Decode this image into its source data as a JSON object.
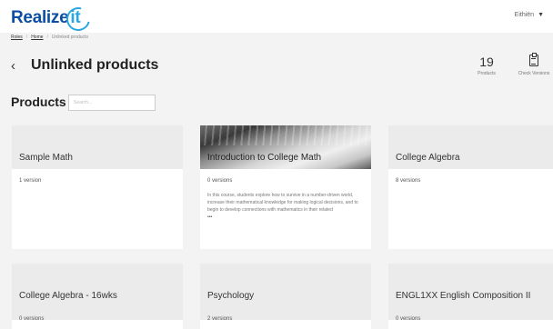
{
  "header": {
    "logo_main": "Realize",
    "logo_accent": "it",
    "user_name": "Eithiën",
    "user_caret": "▼"
  },
  "breadcrumb": {
    "items": [
      "Roles",
      "Home",
      "Unlinked products"
    ],
    "separator": "/"
  },
  "page": {
    "back_icon": "‹",
    "title": "Unlinked products"
  },
  "stats": {
    "products_count": "19",
    "products_label": "Products",
    "check_label": "Check Versions"
  },
  "products": {
    "label": "Products",
    "search_placeholder": "Search..."
  },
  "cards": [
    {
      "title": "Sample Math",
      "versions": "1 version",
      "description": "",
      "more": "",
      "has_image": false
    },
    {
      "title": "Introduction to College Math",
      "versions": "0 versions",
      "description": "In this course, students explore how to survive in a number-driven world, increase their mathematical knowledge for making logical decisions, and to begin to develop connections with mathematics in their related",
      "more": "•••",
      "has_image": true
    },
    {
      "title": "College Algebra",
      "versions": "8 versions",
      "description": "",
      "more": "",
      "has_image": false
    },
    {
      "title": "College Algebra - 16wks",
      "versions": "0 versions",
      "description": "",
      "more": "",
      "has_image": false
    },
    {
      "title": "Psychology",
      "versions": "2 versions",
      "description": "",
      "more": "",
      "has_image": false
    },
    {
      "title": "ENGL1XX English Composition II",
      "versions": "0 versions",
      "description": "",
      "more": "",
      "has_image": false
    }
  ],
  "icons": {
    "back": "chevron-left-icon",
    "check_versions": "clipboard-icon",
    "user_menu": "caret-down-icon"
  },
  "colors": {
    "brand": "#0b4ea2",
    "accent": "#2aa7de",
    "background": "#f3f3f3"
  }
}
